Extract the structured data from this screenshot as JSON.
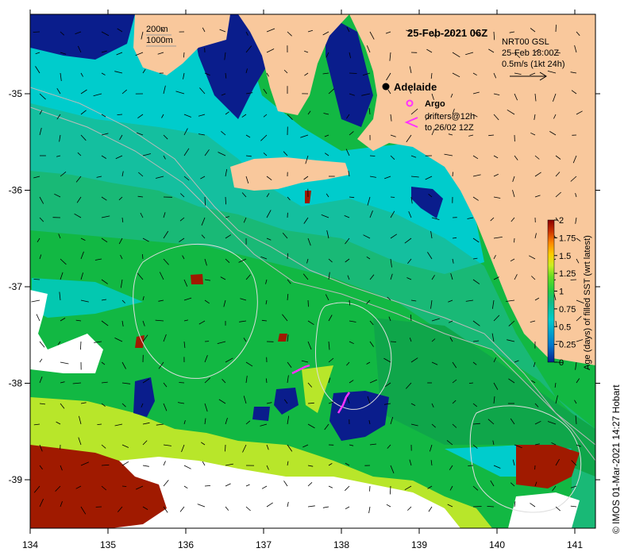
{
  "map": {
    "title": "25-Feb-2021 06Z",
    "bathymetry_legend": [
      "200m",
      "1000m"
    ],
    "current_info": [
      "NRT00 GSL",
      "25-Feb 18:00Z",
      "0.5m/s (1kt 24h)"
    ],
    "city": "Adelaide",
    "argo_label": "Argo",
    "drifters_label": [
      "drifters@12h",
      "to 26/02 12Z"
    ],
    "credit": "© IMOS 01-Mar-2021 14:27 Hobart",
    "colors": {
      "land": "#f9c89c",
      "cyan": "#00cccc",
      "turquoise": "#1db98c",
      "green": "#12b843",
      "deep_green": "#0fa64a",
      "yellow_green": "#b8e62a",
      "dark_red": "#a01a00",
      "dark_blue": "#0a1d8c",
      "white": "#ffffff",
      "magenta": "#ff33ff"
    }
  },
  "axes": {
    "x_ticks": [
      "134",
      "135",
      "136",
      "137",
      "138",
      "139",
      "140",
      "141"
    ],
    "y_ticks": [
      "-35",
      "-36",
      "-37",
      "-38",
      "-39"
    ]
  },
  "colorbar": {
    "label": "Age (days) of filled SST (wrt latest)",
    "ticks": [
      "2",
      "1.75",
      "1.5",
      "1.25",
      "1",
      "0.75",
      "0.5",
      "0.25",
      "0"
    ],
    "colors": [
      "#8b0000",
      "#cc3300",
      "#ff8800",
      "#ffcc00",
      "#ccee22",
      "#66dd22",
      "#22cc44",
      "#11bb88",
      "#00cccc",
      "#0077cc",
      "#0a1d8c"
    ]
  }
}
